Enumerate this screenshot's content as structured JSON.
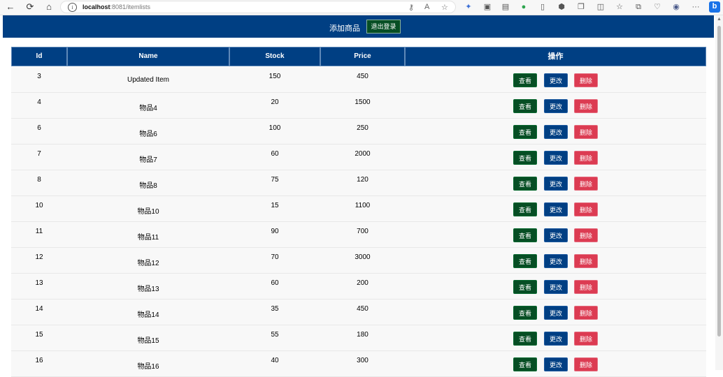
{
  "browser": {
    "url_host": "localhost",
    "url_rest": ":8081/itemlists",
    "back_icon": "back-arrow-icon",
    "forward_icon": "forward-arrow-icon",
    "refresh_icon": "refresh-icon",
    "home_icon": "home-icon",
    "toolbar_more": "···"
  },
  "header": {
    "add_label": "添加商品",
    "logout_label": "退出登录"
  },
  "table": {
    "columns": [
      "Id",
      "Name",
      "Stock",
      "Price",
      "操作"
    ],
    "action_labels": {
      "view": "查看",
      "edit": "更改",
      "delete": "删除"
    },
    "rows": [
      {
        "id": "3",
        "name": "Updated Item",
        "stock": "150",
        "price": "450"
      },
      {
        "id": "4",
        "name": "物品4",
        "stock": "20",
        "price": "1500"
      },
      {
        "id": "6",
        "name": "物品6",
        "stock": "100",
        "price": "250"
      },
      {
        "id": "7",
        "name": "物品7",
        "stock": "60",
        "price": "2000"
      },
      {
        "id": "8",
        "name": "物品8",
        "stock": "75",
        "price": "120"
      },
      {
        "id": "10",
        "name": "物品10",
        "stock": "15",
        "price": "1100"
      },
      {
        "id": "11",
        "name": "物品11",
        "stock": "90",
        "price": "700"
      },
      {
        "id": "12",
        "name": "物品12",
        "stock": "70",
        "price": "3000"
      },
      {
        "id": "13",
        "name": "物品13",
        "stock": "60",
        "price": "200"
      },
      {
        "id": "14",
        "name": "物品14",
        "stock": "35",
        "price": "450"
      },
      {
        "id": "15",
        "name": "物品15",
        "stock": "55",
        "price": "180"
      },
      {
        "id": "16",
        "name": "物品16",
        "stock": "40",
        "price": "300"
      }
    ]
  },
  "colors": {
    "header_bg": "#003f83",
    "view_button": "#064e24",
    "edit_button": "#003f83",
    "delete_button": "#dc3b52"
  }
}
